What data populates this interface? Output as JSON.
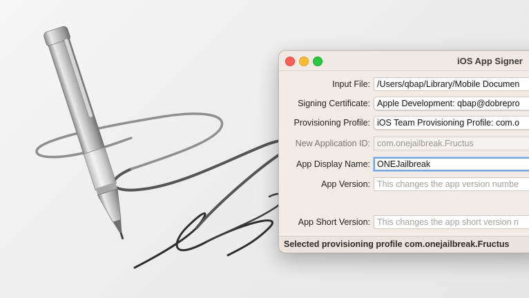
{
  "window": {
    "title": "iOS App Signer",
    "controls": [
      "close",
      "minimize",
      "maximize"
    ]
  },
  "form": {
    "input_file": {
      "label": "Input File:",
      "value": "/Users/qbap/Library/Mobile Documen"
    },
    "signing_certificate": {
      "label": "Signing Certificate:",
      "value": "Apple Development: qbap@dobrepro"
    },
    "provisioning_profile": {
      "label": "Provisioning Profile:",
      "value": "iOS Team Provisioning Profile: com.o"
    },
    "new_application_id": {
      "label": "New Application ID:",
      "value": "com.onejailbreak.Fructus"
    },
    "app_display_name": {
      "label": "App Display Name:",
      "value": "ONEJailbreak"
    },
    "app_version": {
      "label": "App Version:",
      "placeholder": "This changes the app version numbe"
    },
    "app_short_version": {
      "label": "App Short Version:",
      "placeholder": "This changes the app short version n"
    }
  },
  "status": {
    "text": "Selected provisioning profile com.onejailbreak.Fructus"
  },
  "background": {
    "icons": [
      "pen-icon",
      "signature-scribble"
    ]
  }
}
